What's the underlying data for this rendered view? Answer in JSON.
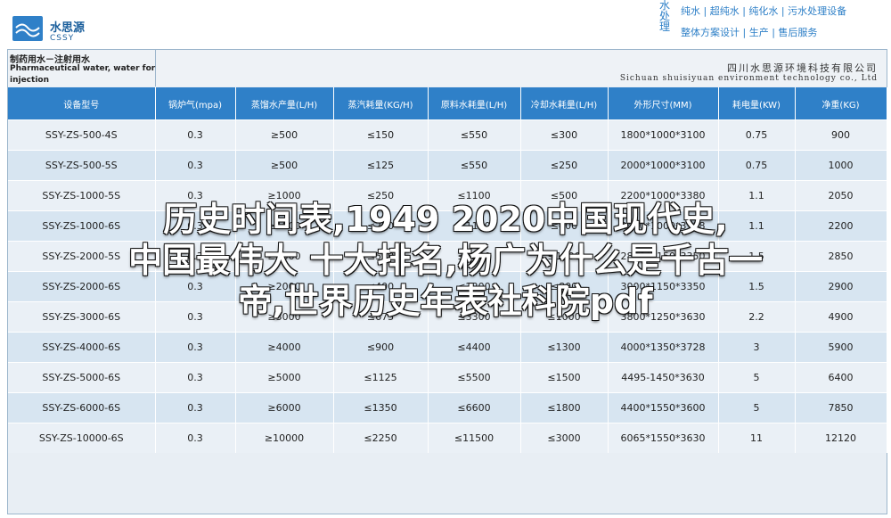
{
  "header": {
    "brand_cn": "水思源",
    "brand_en": "CSSY",
    "tagline_vertical": "水处理",
    "tagline_line1": "纯水 | 超纯水 | 纯化水 | 污水处理设备",
    "tagline_line2": "整体方案设计 | 生产 | 售后服务"
  },
  "table_title": {
    "cn": "制药用水－注射用水",
    "en_line1": "Pharmaceutical water, water for",
    "en_line2": "injection",
    "company_cn": "四川水思源环境科技有限公司",
    "company_en": "Sichuan shuisiyuan environment technology co., Ltd"
  },
  "columns": [
    "设备型号",
    "锅炉气(mpa)",
    "蒸馏水产量(L/H)",
    "蒸汽耗量(KG/H)",
    "原料水耗量(L/H)",
    "冷却水耗量(L/H)",
    "外形尺寸(MM)",
    "耗电量(KW)",
    "净重(KG)"
  ],
  "rows": [
    [
      "SSY-ZS-500-4S",
      "0.3",
      "≥500",
      "≤150",
      "≤550",
      "≤300",
      "1800*1000*3100",
      "0.75",
      "900"
    ],
    [
      "SSY-ZS-500-5S",
      "0.3",
      "≥500",
      "≤125",
      "≤550",
      "≤250",
      "2000*1000*3100",
      "0.75",
      "1000"
    ],
    [
      "SSY-ZS-1000-5S",
      "0.3",
      "≥1000",
      "≤250",
      "≤1100",
      "≤500",
      "2200*1000*3380",
      "1.1",
      "2050"
    ],
    [
      "SSY-ZS-1000-6S",
      "0.3",
      "≥1000",
      "≤200",
      "≤1100",
      "≤400",
      "2400*1000*3118",
      "1.1",
      "2200"
    ],
    [
      "SSY-ZS-2000-5S",
      "0.3",
      "≥2000",
      "≤500",
      "≤2200",
      "≤1000",
      "2800*1150*3350",
      "1.5",
      "2850"
    ],
    [
      "SSY-ZS-2000-6S",
      "0.3",
      "≥2000",
      "≤400",
      "≤2200",
      "≤800",
      "3000*1150*3350",
      "1.5",
      "2900"
    ],
    [
      "SSY-ZS-3000-6S",
      "0.3",
      "≥3000",
      "≤675",
      "≤3300",
      "≤1000",
      "3800*1250*3630",
      "2.2",
      "4900"
    ],
    [
      "SSY-ZS-4000-6S",
      "0.3",
      "≥4000",
      "≤900",
      "≤4400",
      "≤1300",
      "4000*1350*3728",
      "3",
      "5900"
    ],
    [
      "SSY-ZS-5000-6S",
      "0.3",
      "≥5000",
      "≤1125",
      "≤5500",
      "≤1500",
      "4495-1450*3630",
      "5",
      "6400"
    ],
    [
      "SSY-ZS-6000-6S",
      "0.3",
      "≥6000",
      "≤1350",
      "≤6600",
      "≤1800",
      "4400*1550*3600",
      "5",
      "7850"
    ],
    [
      "SSY-ZS-10000-6S",
      "0.3",
      "≥10000",
      "≤2250",
      "≤11500",
      "≤3000",
      "6065*1550*3630",
      "11",
      "12120"
    ]
  ],
  "overlay": {
    "line1": "历史时间表,1949 2020中国现代史,",
    "line2": "中国最伟大 十大排名,杨广为什么是千古一",
    "line3": "帝,世界历史年表社科院pdf"
  },
  "colors": {
    "header_blue": "#2f80c8",
    "row_light": "#eaf0f6",
    "row_dark": "#d7e5f1",
    "brand_blue": "#1b5f9c"
  }
}
